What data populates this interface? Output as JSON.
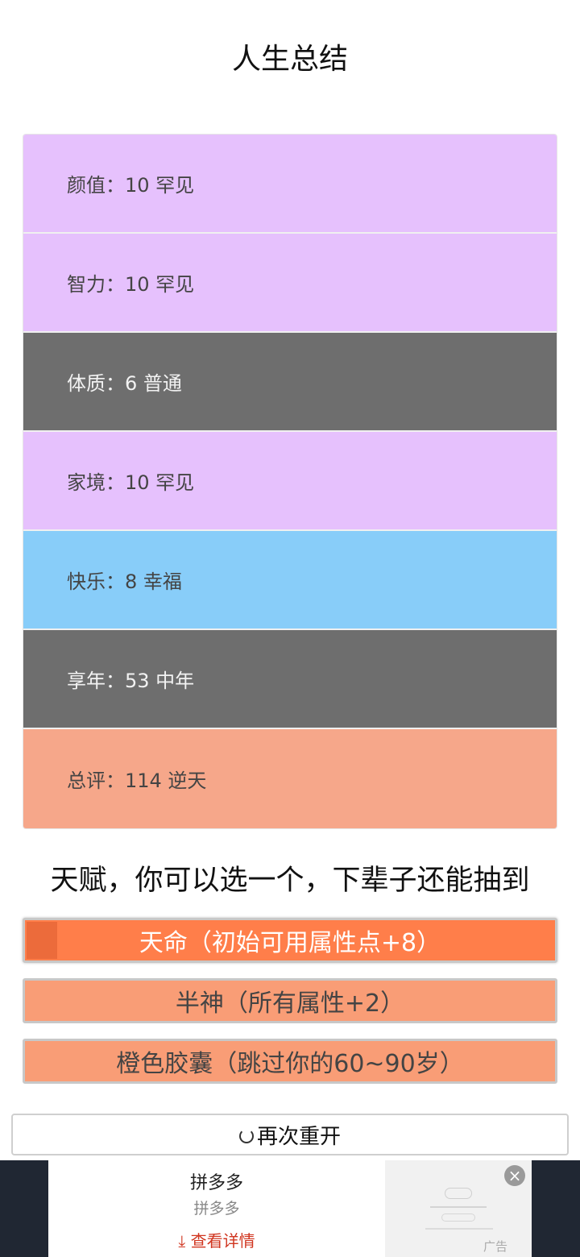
{
  "title": "人生总结",
  "stats": [
    {
      "label": "颜值：10 罕见",
      "color": "#e6c1fd"
    },
    {
      "label": "智力：10 罕见",
      "color": "#e6c1fd"
    },
    {
      "label": "体质：6 普通",
      "color": "#6e6e6e"
    },
    {
      "label": "家境：10 罕见",
      "color": "#e6c1fd"
    },
    {
      "label": "快乐：8 幸福",
      "color": "#88cdf9"
    },
    {
      "label": "享年：53 中年",
      "color": "#6e6e6e"
    },
    {
      "label": "总评：114 逆天",
      "color": "#f6a78a"
    }
  ],
  "talents": {
    "heading": "天赋，你可以选一个，下辈子还能抽到",
    "items": [
      {
        "label": "天命（初始可用属性点+8）",
        "selected": true
      },
      {
        "label": "半神（所有属性+2）",
        "selected": false
      },
      {
        "label": "橙色胶囊（跳过你的60~90岁）",
        "selected": false
      }
    ]
  },
  "restart": {
    "label": "再次重开",
    "icon": "refresh-icon"
  },
  "ad": {
    "title": "拼多多",
    "subtitle": "拼多多",
    "cta": "查看详情",
    "cta_icon": "download-arrow-icon",
    "tag": "广告",
    "close_icon": "close-icon"
  }
}
